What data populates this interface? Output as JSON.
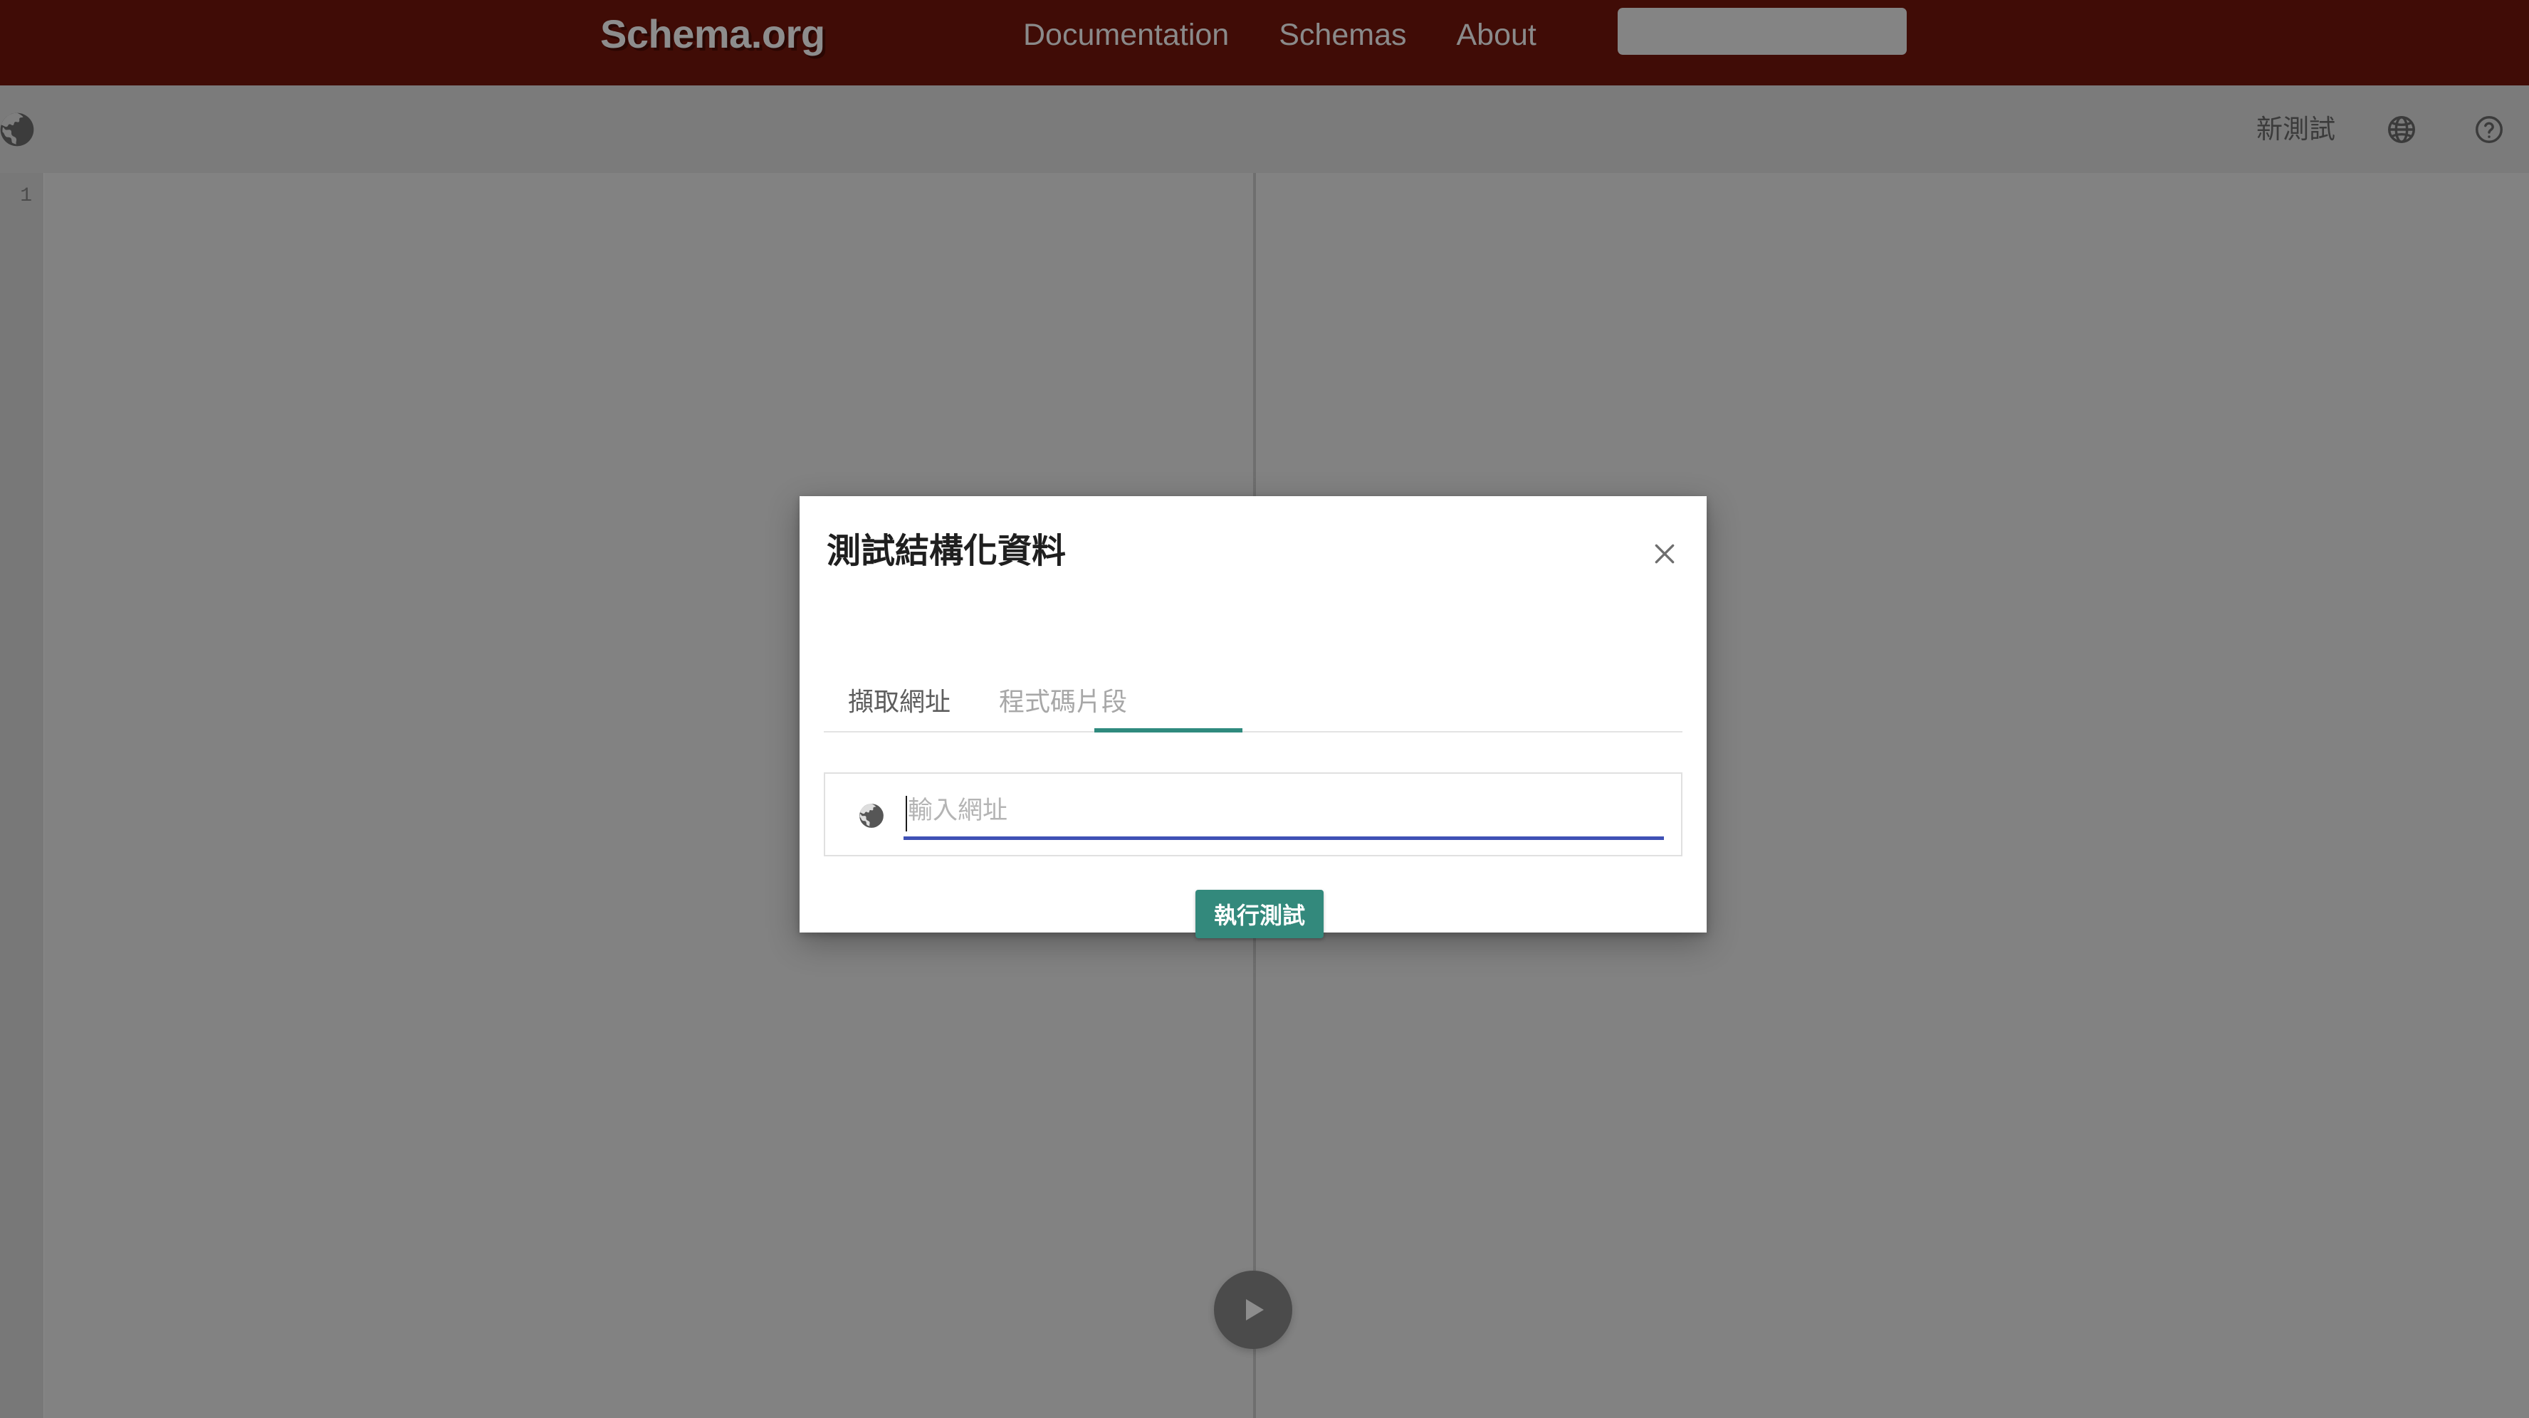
{
  "site_header": {
    "logo": "Schema.org",
    "nav": [
      {
        "label": "Documentation"
      },
      {
        "label": "Schemas"
      },
      {
        "label": "About"
      }
    ],
    "search": {
      "value": "",
      "placeholder": "",
      "icon": "search-icon"
    },
    "background_color": "#400c06"
  },
  "app_bar": {
    "left_icon": "globe-icon",
    "new_test_label": "新測試",
    "language_icon": "globe-language-icon",
    "help_icon": "help-circle-icon"
  },
  "editor": {
    "line_numbers": [
      "1"
    ],
    "content": "",
    "play_button_icon": "play-icon"
  },
  "modal": {
    "title": "測試結構化資料",
    "close_icon": "close-icon",
    "tabs": [
      {
        "label": "擷取網址",
        "active": true
      },
      {
        "label": "程式碼片段",
        "active": false
      }
    ],
    "url_field": {
      "icon": "globe-icon",
      "value": "",
      "placeholder": "輸入網址",
      "focus_underline_color": "#3f51b5"
    },
    "run_button": {
      "label": "執行測試",
      "color": "#33897c"
    }
  },
  "colors": {
    "header_maroon": "#400c06",
    "teal_accent": "#2f8a7e",
    "overlay_grey": "#808080",
    "indigo": "#3f51b5"
  }
}
